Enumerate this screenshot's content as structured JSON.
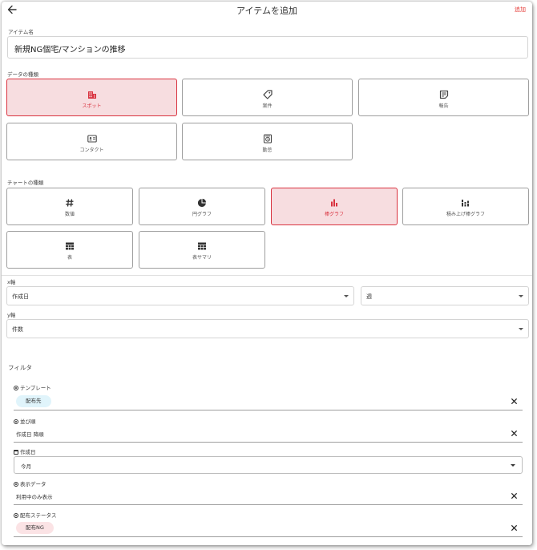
{
  "header": {
    "title": "アイテムを追加",
    "add_label": "追加"
  },
  "item_name": {
    "label": "アイテム名",
    "value": "新規NG個宅/マンションの推移"
  },
  "data_type": {
    "label": "データの種類",
    "options": [
      {
        "label": "スポット",
        "icon": "building-icon",
        "selected": true
      },
      {
        "label": "案件",
        "icon": "tag-icon",
        "selected": false
      },
      {
        "label": "報告",
        "icon": "note-icon",
        "selected": false
      },
      {
        "label": "コンタクト",
        "icon": "contact-card-icon",
        "selected": false
      },
      {
        "label": "勤怠",
        "icon": "timeclock-icon",
        "selected": false
      }
    ]
  },
  "chart_type": {
    "label": "チャートの種類",
    "options": [
      {
        "label": "数値",
        "icon": "hash-icon",
        "selected": false
      },
      {
        "label": "円グラフ",
        "icon": "pie-chart-icon",
        "selected": false
      },
      {
        "label": "棒グラフ",
        "icon": "bar-chart-icon",
        "selected": true
      },
      {
        "label": "積み上げ棒グラフ",
        "icon": "stacked-bar-chart-icon",
        "selected": false
      },
      {
        "label": "表",
        "icon": "table-icon",
        "selected": false
      },
      {
        "label": "表サマリ",
        "icon": "table-summary-icon",
        "selected": false
      }
    ]
  },
  "x_axis": {
    "label": "x軸",
    "field": "作成日",
    "interval": "週"
  },
  "y_axis": {
    "label": "y軸",
    "field": "件数"
  },
  "filter": {
    "title": "フィルタ",
    "template": {
      "label": "テンプレート",
      "chip": "配布先"
    },
    "sort": {
      "label": "並び順",
      "value": "作成日 降順"
    },
    "created": {
      "label": "作成日",
      "value": "今月"
    },
    "display": {
      "label": "表示データ",
      "value": "利用中のみ表示"
    },
    "status": {
      "label": "配布ステータス",
      "chip": "配布NG"
    }
  },
  "colors": {
    "accent": "#d9323f",
    "selected_bg": "#f7dde0",
    "chip_blue": "#e0f4fb",
    "chip_pink": "#fbe3e5"
  }
}
